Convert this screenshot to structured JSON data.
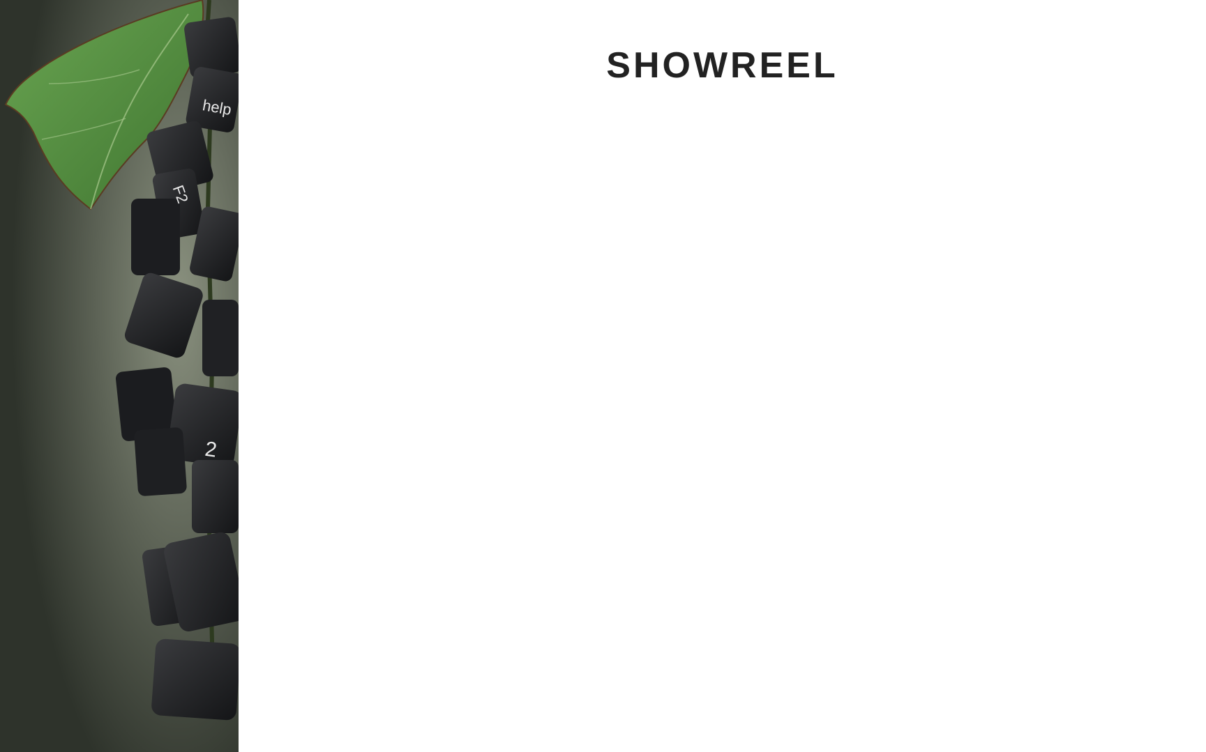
{
  "side_image": {
    "alt_description_icon": "leaf-and-keycaps-image",
    "keycap_labels": [
      "help",
      "F2",
      "2"
    ],
    "colors": {
      "background": "#4a5145",
      "leaf": "#4e8a3a",
      "keycap": "#1f2022"
    }
  },
  "main": {
    "title": "SHOWREEL"
  }
}
